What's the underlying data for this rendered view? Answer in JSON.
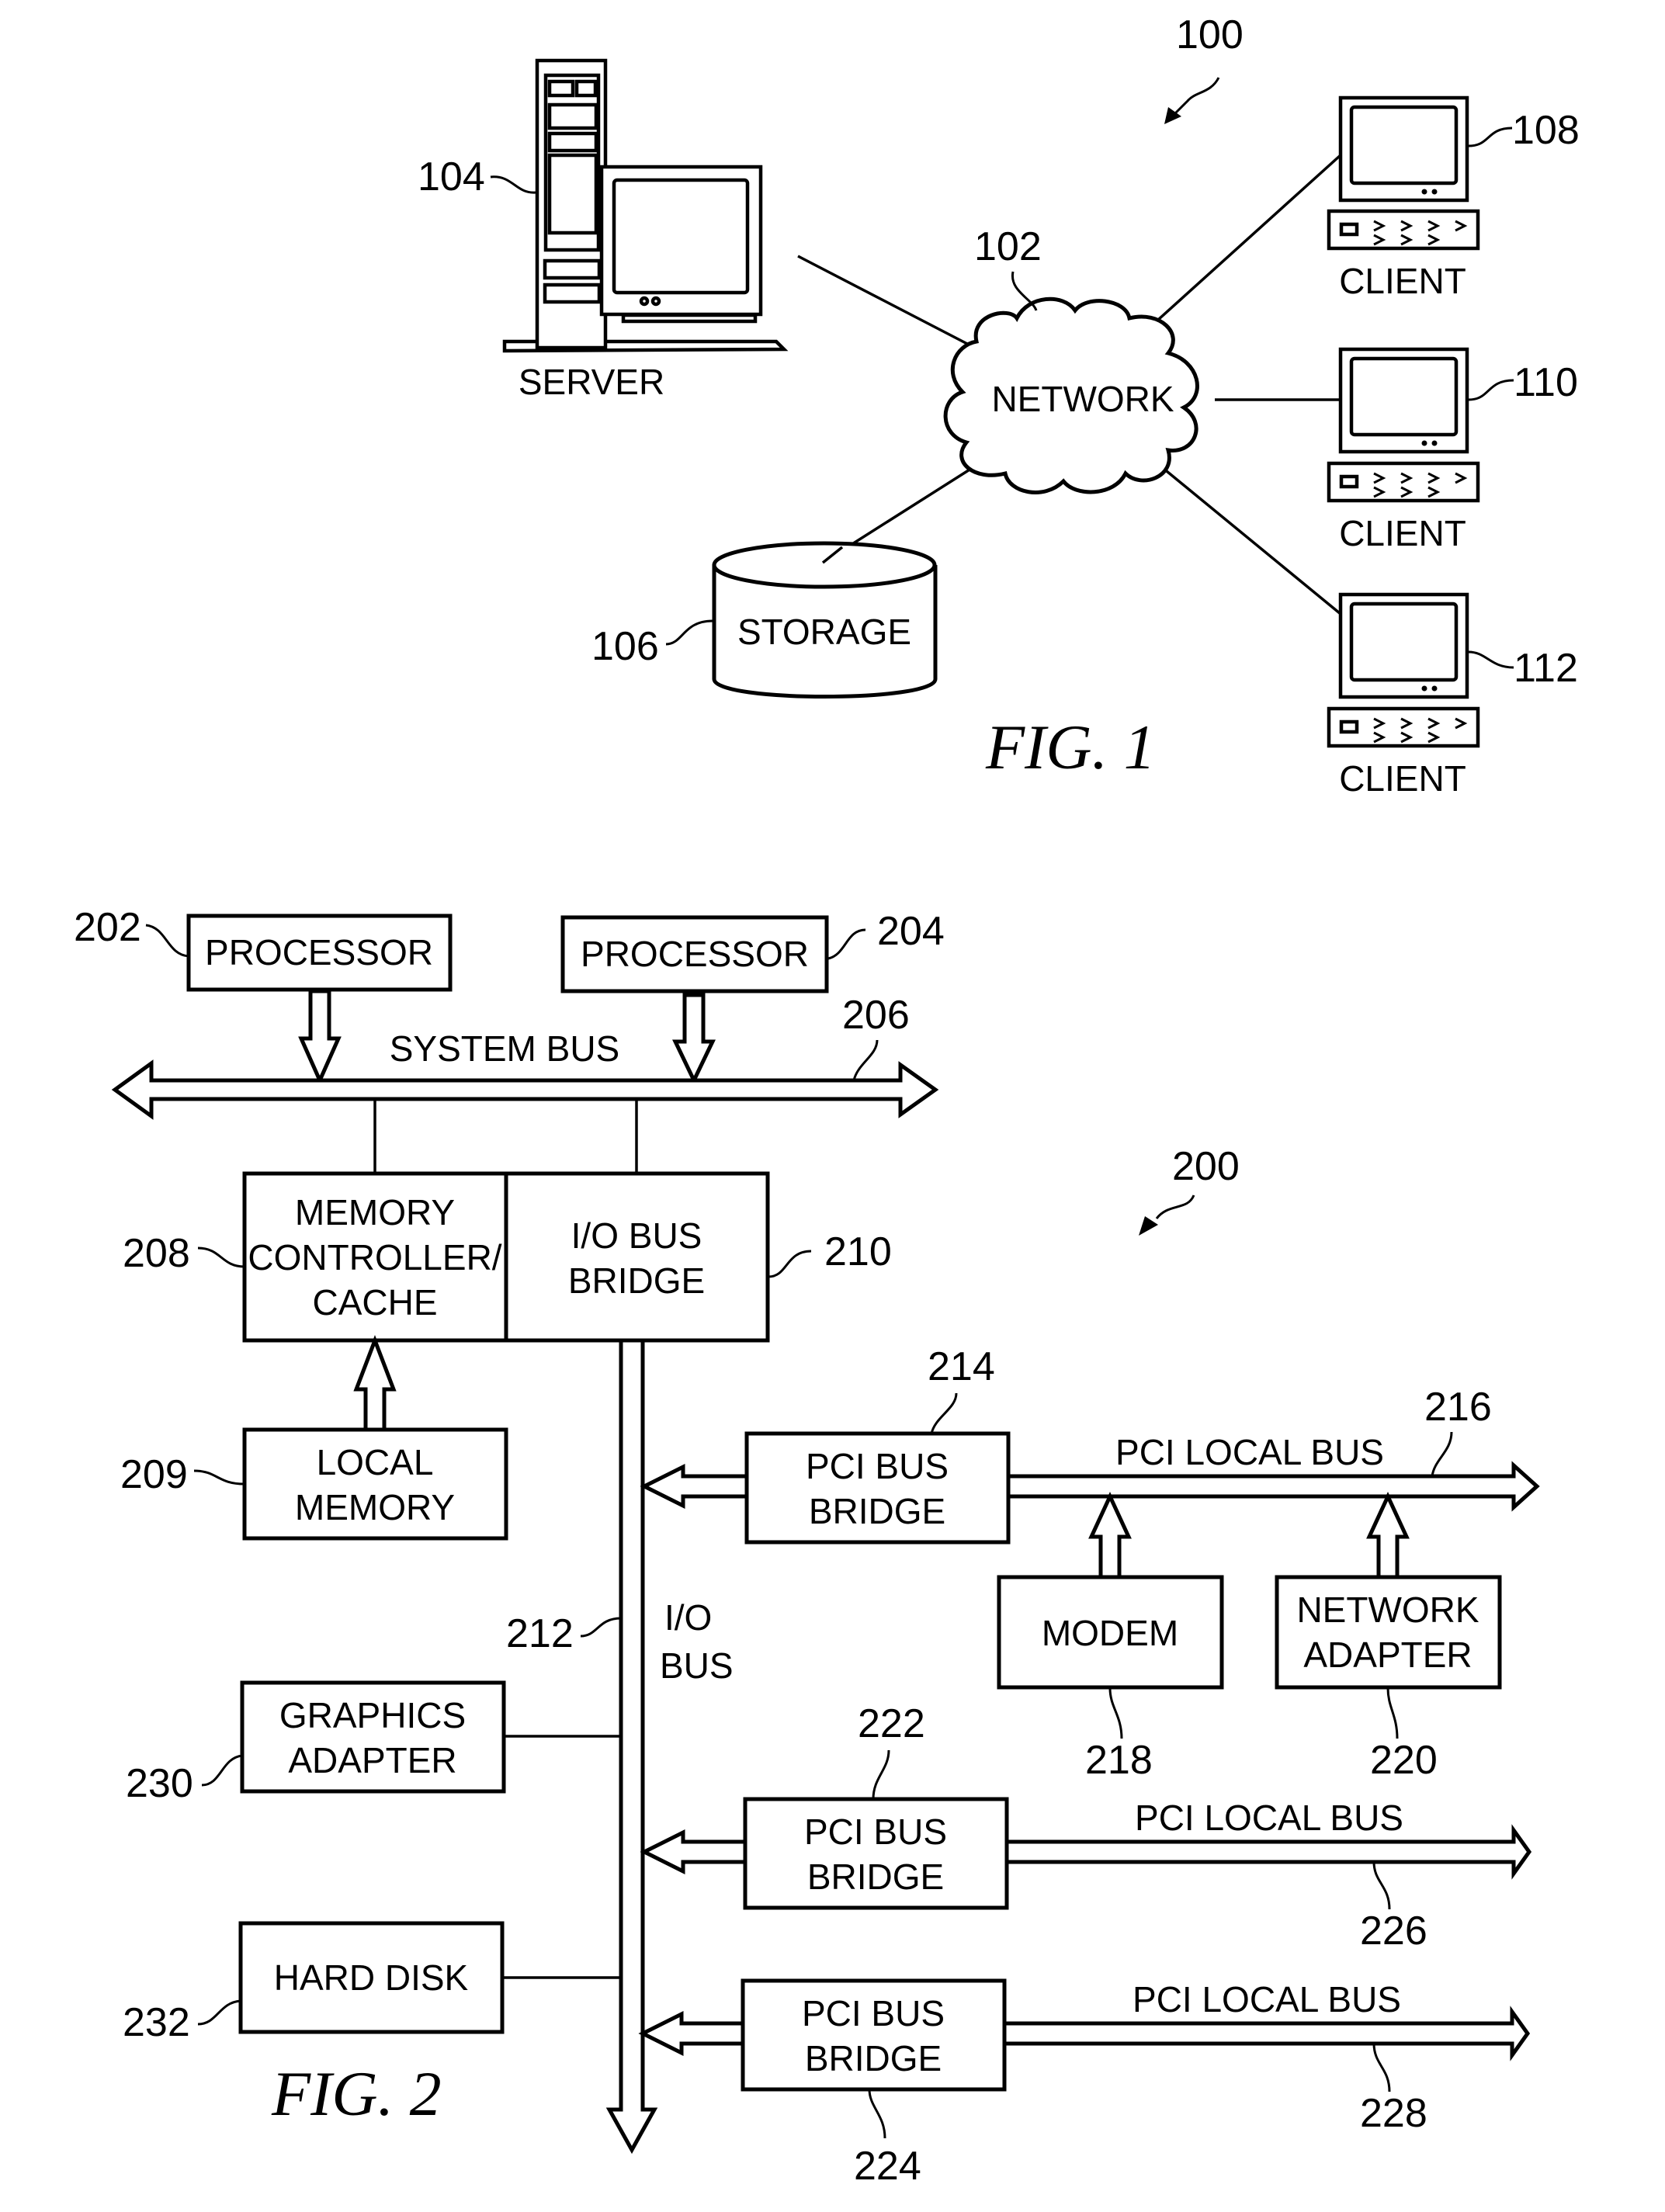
{
  "colors": {
    "ink": "#000000",
    "paper": "#ffffff"
  },
  "fig1": {
    "caption": "FIG. 1",
    "ref_system": "100",
    "network": {
      "ref": "102",
      "label": "NETWORK"
    },
    "server": {
      "ref": "104",
      "label": "SERVER",
      "icon": "server-computer-icon"
    },
    "storage": {
      "ref": "106",
      "label": "STORAGE",
      "icon": "database-cylinder-icon"
    },
    "clients": [
      {
        "ref": "108",
        "label": "CLIENT",
        "icon": "client-computer-icon"
      },
      {
        "ref": "110",
        "label": "CLIENT",
        "icon": "client-computer-icon"
      },
      {
        "ref": "112",
        "label": "CLIENT",
        "icon": "client-computer-icon"
      }
    ]
  },
  "fig2": {
    "caption": "FIG. 2",
    "ref_system": "200",
    "processor_a": {
      "ref": "202",
      "label": "PROCESSOR"
    },
    "processor_b": {
      "ref": "204",
      "label": "PROCESSOR"
    },
    "system_bus": {
      "ref": "206",
      "label": "SYSTEM BUS"
    },
    "mem_ctrl": {
      "ref": "208",
      "lines": [
        "MEMORY",
        "CONTROLLER/",
        "CACHE"
      ]
    },
    "local_mem": {
      "ref": "209",
      "lines": [
        "LOCAL",
        "MEMORY"
      ]
    },
    "io_bridge": {
      "ref": "210",
      "lines": [
        "I/O BUS",
        "BRIDGE"
      ]
    },
    "io_bus": {
      "ref": "212",
      "lines": [
        "I/O",
        "BUS"
      ]
    },
    "pci_bridge_1": {
      "ref": "214",
      "lines": [
        "PCI BUS",
        "BRIDGE"
      ]
    },
    "pci_bus_1": {
      "ref": "216",
      "label": "PCI LOCAL BUS"
    },
    "modem": {
      "ref": "218",
      "label": "MODEM"
    },
    "net_adapter": {
      "ref": "220",
      "lines": [
        "NETWORK",
        "ADAPTER"
      ]
    },
    "pci_bridge_2": {
      "ref": "222",
      "lines": [
        "PCI BUS",
        "BRIDGE"
      ]
    },
    "pci_bridge_3": {
      "ref": "224",
      "lines": [
        "PCI BUS",
        "BRIDGE"
      ]
    },
    "pci_bus_2": {
      "ref": "226",
      "label": "PCI LOCAL BUS"
    },
    "pci_bus_3": {
      "ref": "228",
      "label": "PCI LOCAL BUS"
    },
    "graphics": {
      "ref": "230",
      "lines": [
        "GRAPHICS",
        "ADAPTER"
      ]
    },
    "hard_disk": {
      "ref": "232",
      "label": "HARD DISK"
    }
  }
}
